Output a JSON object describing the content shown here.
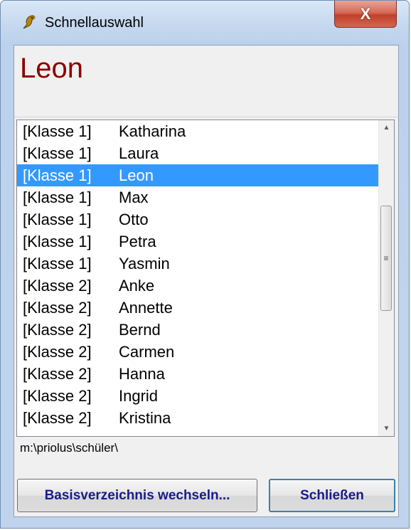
{
  "window": {
    "title": "Schnellauswahl",
    "close_glyph": "X"
  },
  "selected_name": "Leon",
  "list": {
    "items": [
      {
        "class": "[Klasse 1]",
        "name": "Katharina"
      },
      {
        "class": "[Klasse 1]",
        "name": "Laura"
      },
      {
        "class": "[Klasse 1]",
        "name": "Leon"
      },
      {
        "class": "[Klasse 1]",
        "name": "Max"
      },
      {
        "class": "[Klasse 1]",
        "name": "Otto"
      },
      {
        "class": "[Klasse 1]",
        "name": "Petra"
      },
      {
        "class": "[Klasse 1]",
        "name": "Yasmin"
      },
      {
        "class": "[Klasse 2]",
        "name": "Anke"
      },
      {
        "class": "[Klasse 2]",
        "name": "Annette"
      },
      {
        "class": "[Klasse 2]",
        "name": "Bernd"
      },
      {
        "class": "[Klasse 2]",
        "name": "Carmen"
      },
      {
        "class": "[Klasse 2]",
        "name": "Hanna"
      },
      {
        "class": "[Klasse 2]",
        "name": "Ingrid"
      },
      {
        "class": "[Klasse 2]",
        "name": "Kristina"
      }
    ],
    "selected_index": 2,
    "selection_color": "#3399ff"
  },
  "path": "m:\\priolus\\schüler\\",
  "buttons": {
    "basis_label": "Basisverzeichnis wechseln...",
    "close_label": "Schließen"
  },
  "icons": {
    "app": "bird-icon",
    "scroll_up": "arrow-up-icon",
    "scroll_down": "arrow-down-icon",
    "thumb_grip": "grip-icon"
  }
}
